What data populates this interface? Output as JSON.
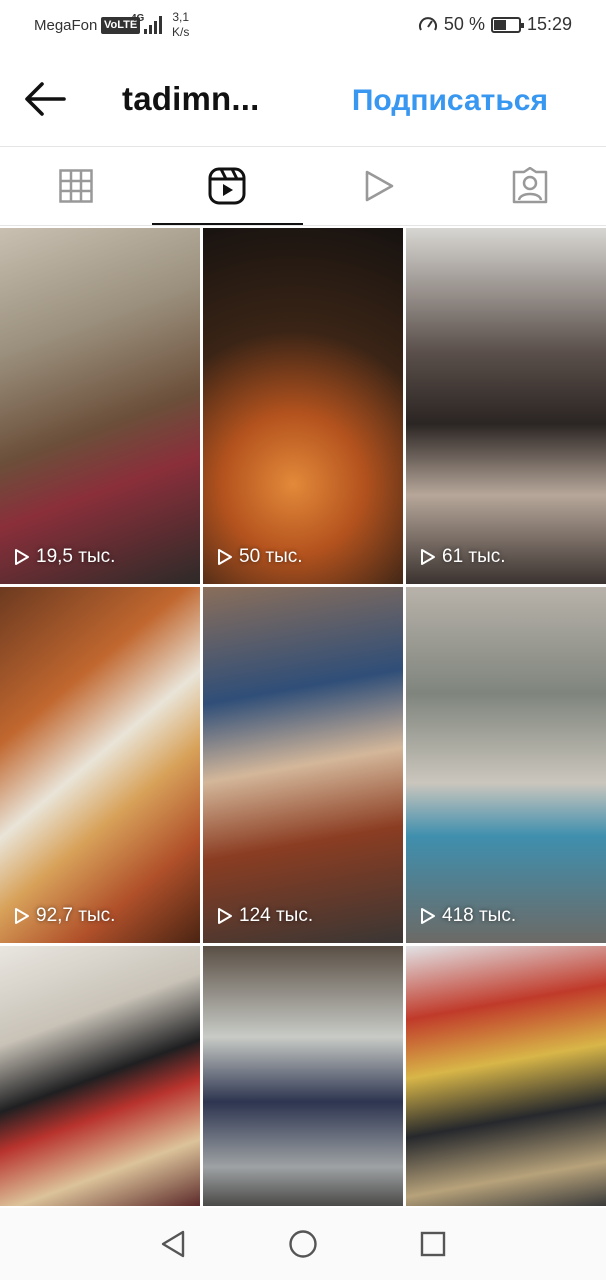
{
  "status_bar": {
    "carrier": "MegaFon",
    "volte": "VoLTE",
    "network": "4G",
    "speed_value": "3,1",
    "speed_unit": "K/s",
    "battery_text": "50 %",
    "battery_level": 0.5,
    "time": "15:29"
  },
  "header": {
    "back_icon": "arrow-left-icon",
    "title": "tadimn...",
    "subscribe_label": "Подписаться",
    "subscribe_color": "#3897f0"
  },
  "tabs": [
    {
      "name": "grid",
      "icon": "grid-icon",
      "active": false
    },
    {
      "name": "reels",
      "icon": "reels-icon",
      "active": true
    },
    {
      "name": "videos",
      "icon": "play-icon",
      "active": false
    },
    {
      "name": "tagged",
      "icon": "tagged-person-icon",
      "active": false
    }
  ],
  "reels": [
    {
      "views": "19,5 тыс."
    },
    {
      "views": "50 тыс."
    },
    {
      "views": "61 тыс."
    },
    {
      "views": "92,7 тыс."
    },
    {
      "views": "124 тыс."
    },
    {
      "views": "418 тыс."
    },
    {
      "views": ""
    },
    {
      "views": ""
    },
    {
      "views": ""
    }
  ],
  "navbar": {
    "back": "triangle-back-icon",
    "home": "circle-home-icon",
    "recents": "square-recents-icon"
  }
}
